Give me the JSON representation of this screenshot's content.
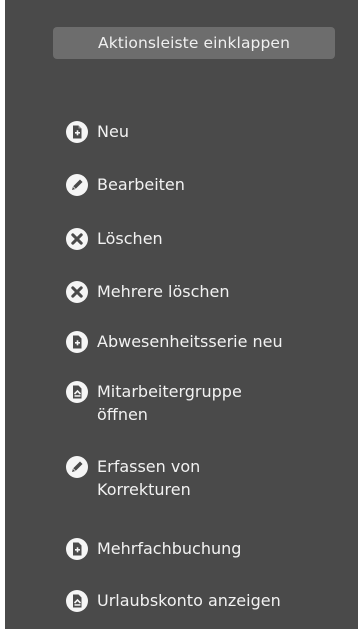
{
  "panel": {
    "collapse_label": "Aktionsleiste einklappen"
  },
  "colors": {
    "panel_bg": "#4a4a4a",
    "button_bg": "#6d6d6d",
    "text": "#f2f2f2",
    "icon_fg": "#f5f5f5",
    "icon_glyph": "#4a4a4a"
  },
  "actions": [
    {
      "label": "Neu",
      "icon": "new-document-icon"
    },
    {
      "label": "Bearbeiten",
      "icon": "pencil-icon"
    },
    {
      "label": "Löschen",
      "icon": "delete-x-icon"
    },
    {
      "label": "Mehrere löschen",
      "icon": "delete-x-icon"
    },
    {
      "label": "Abwesenheitsserie neu",
      "icon": "new-document-icon"
    },
    {
      "label": "Mitarbeitergruppe öffnen",
      "label_lines": [
        "Mitarbeitergruppe",
        "öffnen"
      ],
      "icon": "open-document-icon"
    },
    {
      "label": "Erfassen von Korrekturen",
      "label_lines": [
        "Erfassen von",
        "Korrekturen"
      ],
      "icon": "pencil-icon"
    },
    {
      "label": "Mehrfachbuchung",
      "icon": "new-document-icon"
    },
    {
      "label": "Urlaubskonto anzeigen",
      "icon": "open-document-icon"
    }
  ]
}
